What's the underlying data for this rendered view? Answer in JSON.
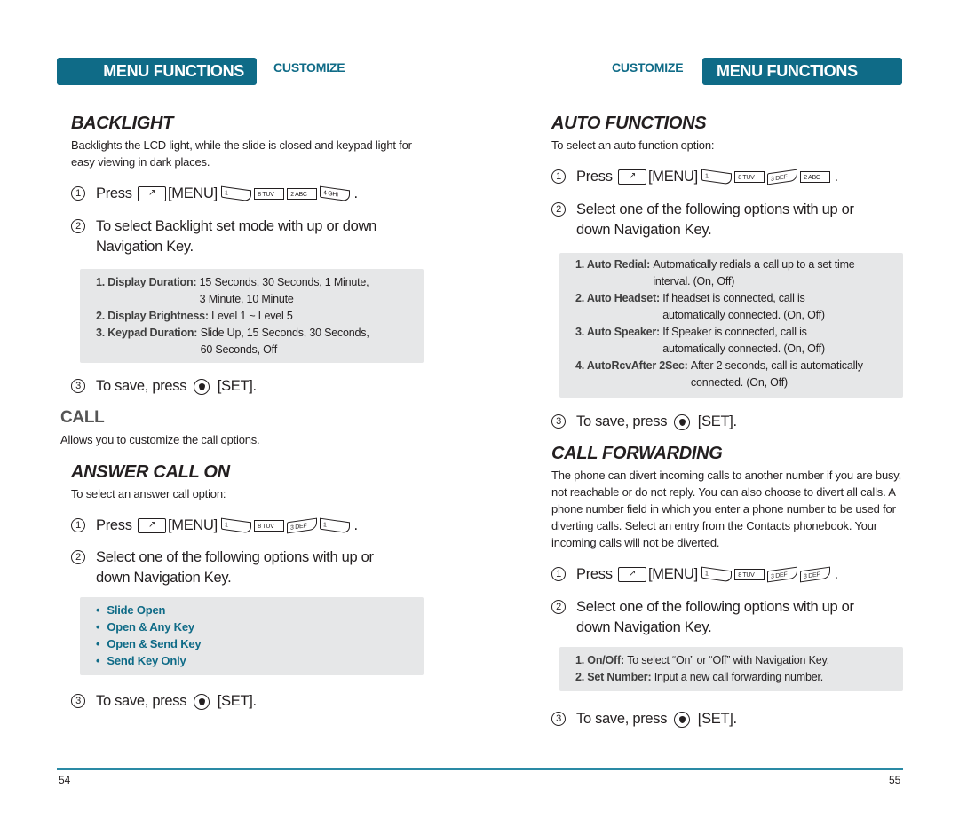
{
  "left_page": {
    "header": {
      "tab": "MENU FUNCTIONS",
      "section": "CUSTOMIZE"
    },
    "backlight": {
      "title": "BACKLIGHT",
      "description": "Backlights the LCD light, while the slide is closed and keypad light for easy viewing in dark places.",
      "step1": {
        "num": "1",
        "text": "Press",
        "softkey_label": "[MENU]",
        "keys": [
          "1",
          "8 TUV",
          "2 ABC",
          "4 GHI"
        ],
        "end": "."
      },
      "step2": {
        "num": "2",
        "text": "To select Backlight set mode with up or down Navigation Key."
      },
      "options": [
        {
          "label": "1. Display Duration:",
          "value": "15 Seconds, 30 Seconds, 1 Minute,\n3 Minute, 10 Minute"
        },
        {
          "label": "2. Display Brightness:",
          "value": "Level 1 ~ Level 5"
        },
        {
          "label": "3. Keypad Duration:",
          "value": "Slide Up, 15 Seconds, 30 Seconds,\n60 Seconds, Off"
        }
      ],
      "step3": {
        "num": "3",
        "text": "To save, press",
        "set_label": "[SET]."
      }
    },
    "call": {
      "title": "CALL",
      "description": "Allows you to customize the call options."
    },
    "answer_call_on": {
      "title": "ANSWER CALL ON",
      "description": "To select an answer call option:",
      "step1": {
        "num": "1",
        "text": "Press",
        "softkey_label": "[MENU]",
        "keys": [
          "1",
          "8 TUV",
          "3 DEF",
          "1"
        ],
        "end": "."
      },
      "step2": {
        "num": "2",
        "text": "Select one of the following options with up or down Navigation Key."
      },
      "options": [
        "Slide Open",
        "Open & Any Key",
        "Open & Send Key",
        "Send Key Only"
      ],
      "step3": {
        "num": "3",
        "text": "To save, press",
        "set_label": "[SET]."
      }
    },
    "page_number": "54"
  },
  "right_page": {
    "header": {
      "tab": "MENU FUNCTIONS",
      "section": "CUSTOMIZE"
    },
    "auto_functions": {
      "title": "AUTO FUNCTIONS",
      "description": "To select an auto function option:",
      "step1": {
        "num": "1",
        "text": "Press",
        "softkey_label": "[MENU]",
        "keys": [
          "1",
          "8 TUV",
          "3 DEF",
          "2 ABC"
        ],
        "end": "."
      },
      "step2": {
        "num": "2",
        "text": "Select one of the following options with up or down Navigation Key."
      },
      "options": [
        {
          "label": "1. Auto Redial:",
          "value": "Automatically redials a call up to a set time\ninterval. (On, Off)"
        },
        {
          "label": "2. Auto Headset:",
          "value": "If headset is connected, call is\nautomatically connected. (On, Off)"
        },
        {
          "label": "3. Auto Speaker:",
          "value": "If Speaker is connected, call is\nautomatically connected. (On, Off)"
        },
        {
          "label": "4. AutoRcvAfter 2Sec:",
          "value": "After 2 seconds, call is automatically\nconnected. (On, Off)"
        }
      ],
      "step3": {
        "num": "3",
        "text": "To save, press",
        "set_label": "[SET]."
      }
    },
    "call_forwarding": {
      "title": "CALL FORWARDING",
      "description": "The phone can divert incoming calls to another number if you are busy, not reachable or do not reply. You can also choose to divert all calls. A phone number field in which you enter a phone number to be used for diverting calls. Select an entry from the Contacts phonebook. Your incoming calls will not be diverted.",
      "step1": {
        "num": "1",
        "text": "Press",
        "softkey_label": "[MENU]",
        "keys": [
          "1",
          "8 TUV",
          "3 DEF",
          "3 DEF"
        ],
        "end": "."
      },
      "step2": {
        "num": "2",
        "text": "Select one of the following options with up or down Navigation Key."
      },
      "options": [
        {
          "label": "1. On/Off:",
          "value": "To select “On” or “Off” with Navigation Key."
        },
        {
          "label": "2. Set Number:",
          "value": "Input a new call forwarding number."
        }
      ],
      "step3": {
        "num": "3",
        "text": "To save, press",
        "set_label": "[SET]."
      }
    },
    "page_number": "55"
  },
  "colors": {
    "accent": "#0f6b87",
    "box_bg": "#e6e7e8",
    "text": "#231f20",
    "rule": "#2a8aa5"
  }
}
